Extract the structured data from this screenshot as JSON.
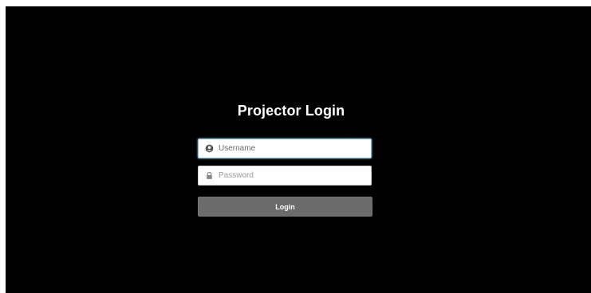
{
  "login": {
    "title": "Projector Login",
    "username": {
      "placeholder": "Username",
      "value": "",
      "icon": "user-icon"
    },
    "password": {
      "placeholder": "Password",
      "value": "",
      "icon": "lock-icon"
    },
    "button_label": "Login"
  },
  "colors": {
    "background": "#000000",
    "button": "#6b6b6b",
    "focus_border": "#7fb6d8"
  }
}
